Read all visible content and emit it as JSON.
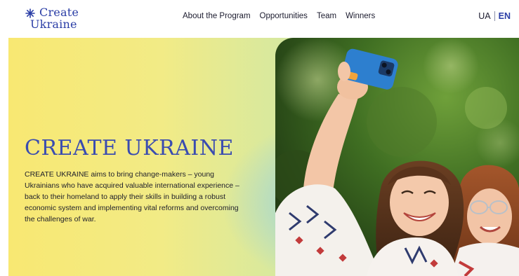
{
  "header": {
    "logo": {
      "line1": "Create",
      "line2": "Ukraine",
      "icon": "sun-burst-icon"
    },
    "nav": [
      {
        "label": "About the Program"
      },
      {
        "label": "Opportunities"
      },
      {
        "label": "Team"
      },
      {
        "label": "Winners"
      }
    ],
    "lang": {
      "ua": "UA",
      "en": "EN",
      "active": "EN"
    }
  },
  "hero": {
    "title": "CREATE UKRAINE",
    "description": "CREATE UKRAINE aims to bring change-makers – young Ukrainians who have acquired valuable international experience – back to their homeland to apply their skills in building a robust economic system and implementing vital reforms and overcoming the challenges of war.",
    "photo": "hero-selfie-photo"
  },
  "colors": {
    "brand_blue": "#2b3ea6",
    "gradient_yellow": "#f8e872",
    "gradient_blue": "#9bd6dd"
  }
}
